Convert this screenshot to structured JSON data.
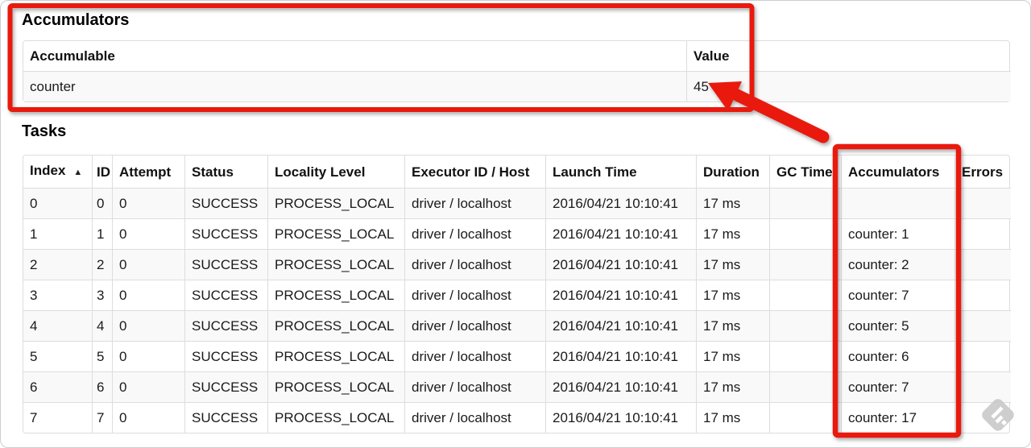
{
  "accumulators_section": {
    "heading": "Accumulators",
    "table": {
      "headers": [
        "Accumulable",
        "Value"
      ],
      "rows": [
        [
          "counter",
          "45"
        ]
      ]
    }
  },
  "tasks_section": {
    "heading": "Tasks",
    "table": {
      "headers": [
        "Index",
        "ID",
        "Attempt",
        "Status",
        "Locality Level",
        "Executor ID / Host",
        "Launch Time",
        "Duration",
        "GC Time",
        "Accumulators",
        "Errors"
      ],
      "sort": {
        "column": "Index",
        "direction": "ascending",
        "icon": "▲"
      },
      "rows": [
        [
          "0",
          "0",
          "0",
          "SUCCESS",
          "PROCESS_LOCAL",
          "driver / localhost",
          "2016/04/21 10:10:41",
          "17 ms",
          "",
          "",
          ""
        ],
        [
          "1",
          "1",
          "0",
          "SUCCESS",
          "PROCESS_LOCAL",
          "driver / localhost",
          "2016/04/21 10:10:41",
          "17 ms",
          "",
          "counter: 1",
          ""
        ],
        [
          "2",
          "2",
          "0",
          "SUCCESS",
          "PROCESS_LOCAL",
          "driver / localhost",
          "2016/04/21 10:10:41",
          "17 ms",
          "",
          "counter: 2",
          ""
        ],
        [
          "3",
          "3",
          "0",
          "SUCCESS",
          "PROCESS_LOCAL",
          "driver / localhost",
          "2016/04/21 10:10:41",
          "17 ms",
          "",
          "counter: 7",
          ""
        ],
        [
          "4",
          "4",
          "0",
          "SUCCESS",
          "PROCESS_LOCAL",
          "driver / localhost",
          "2016/04/21 10:10:41",
          "17 ms",
          "",
          "counter: 5",
          ""
        ],
        [
          "5",
          "5",
          "0",
          "SUCCESS",
          "PROCESS_LOCAL",
          "driver / localhost",
          "2016/04/21 10:10:41",
          "17 ms",
          "",
          "counter: 6",
          ""
        ],
        [
          "6",
          "6",
          "0",
          "SUCCESS",
          "PROCESS_LOCAL",
          "driver / localhost",
          "2016/04/21 10:10:41",
          "17 ms",
          "",
          "counter: 7",
          ""
        ],
        [
          "7",
          "7",
          "0",
          "SUCCESS",
          "PROCESS_LOCAL",
          "driver / localhost",
          "2016/04/21 10:10:41",
          "17 ms",
          "",
          "counter: 17",
          ""
        ]
      ]
    }
  },
  "annotations": {
    "accent_color": "#e9190e",
    "box_1_target": "accumulators-summary-table",
    "box_2_target": "tasks-accumulators-column",
    "arrow_points_at": "45"
  },
  "watermark": {
    "name": "skitch-icon",
    "color": "#c9c9c9"
  }
}
